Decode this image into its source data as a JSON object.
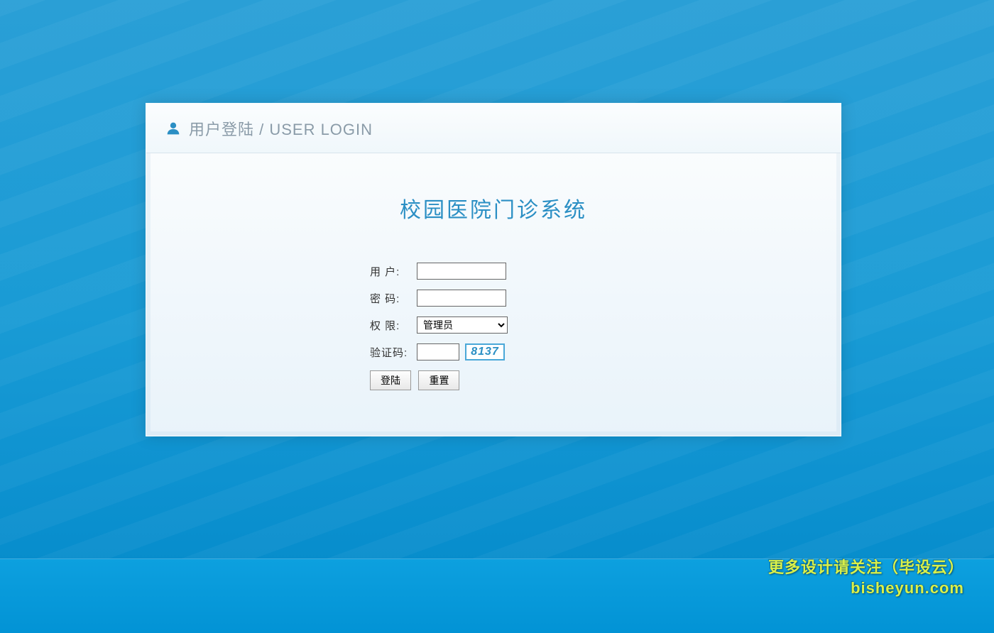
{
  "header": {
    "title": "用户登陆 / USER LOGIN"
  },
  "main": {
    "system_title": "校园医院门诊系统",
    "form": {
      "username_label": "用 户:",
      "username_value": "",
      "password_label": "密 码:",
      "password_value": "",
      "role_label": "权 限:",
      "role_selected": "管理员",
      "captcha_label": "验证码:",
      "captcha_value": "",
      "captcha_image_text": "8137"
    },
    "buttons": {
      "login_label": "登陆",
      "reset_label": "重置"
    }
  },
  "watermark": {
    "line1": "更多设计请关注（毕设云）",
    "line2": "bisheyun.com"
  }
}
